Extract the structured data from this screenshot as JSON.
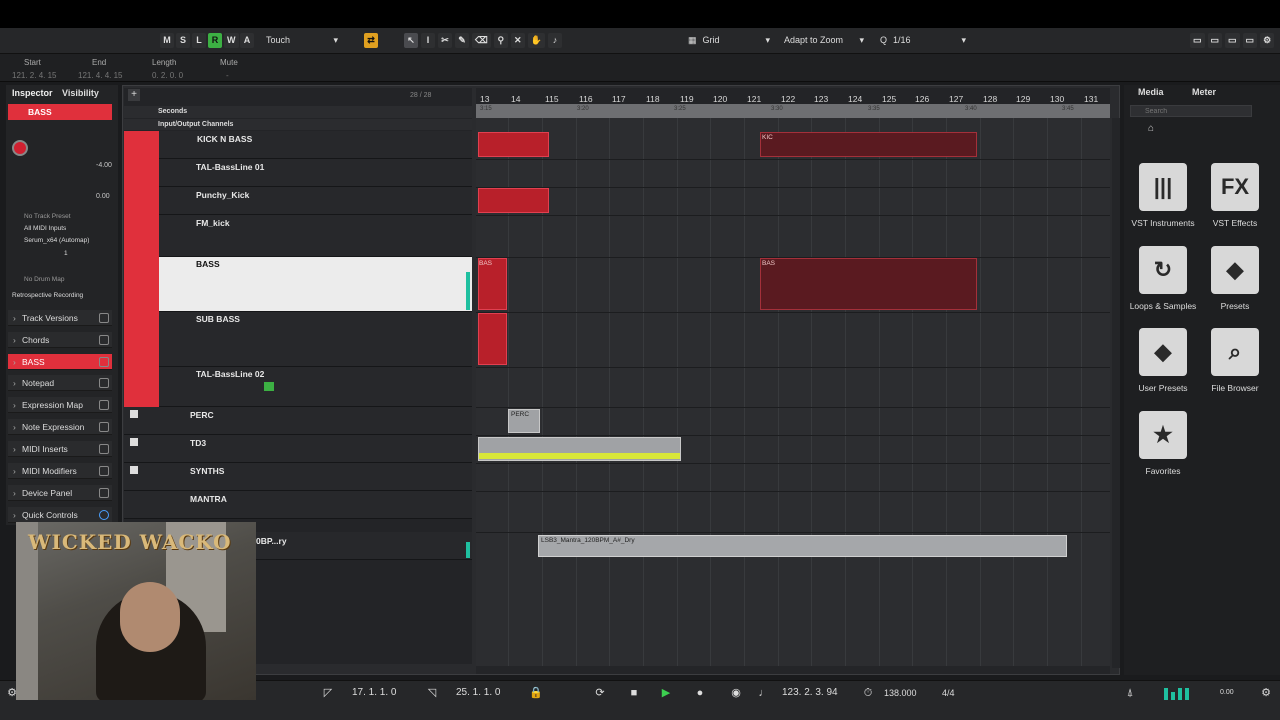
{
  "toolbar": {
    "buttons": [
      "M",
      "S",
      "L",
      "R",
      "W",
      "A"
    ],
    "automation_mode": "Touch",
    "snap_type": "Grid",
    "zoom_mode": "Adapt to Zoom",
    "quantize": "1/16"
  },
  "infoline": {
    "labels": [
      "Start",
      "End",
      "Length",
      "Mute"
    ],
    "values": [
      "121. 2. 4. 15",
      "121. 4. 4. 15",
      "0. 2. 0. 0",
      "-"
    ]
  },
  "inspector": {
    "tabs": [
      "Inspector",
      "Visibility"
    ],
    "track_name": "BASS",
    "volume": "-4.00",
    "pan": "0.00",
    "preset": "No Track Preset",
    "input": "All MIDI Inputs",
    "output": "Serum_x64 (Automap)",
    "channel": "1",
    "drum_map": "No Drum Map",
    "retro": "Retrospective Recording",
    "sections": [
      "Track Versions",
      "Chords",
      "BASS",
      "Notepad",
      "Expression Map",
      "Note Expression",
      "MIDI Inserts",
      "MIDI Modifiers",
      "Device Panel",
      "Quick Controls"
    ]
  },
  "tracklist": {
    "counter": "28 / 28",
    "header_time": "Seconds",
    "io_channels": "Input/Output Channels",
    "tracks": [
      "KICK N BASS",
      "TAL-BassLine 01",
      "Punchy_Kick",
      "FM_kick",
      "BASS",
      "SUB BASS",
      "TAL-BassLine 02",
      "PERC",
      "TD3",
      "SYNTHS",
      "MANTRA"
    ],
    "audio_track_fragment": "0BP...ry"
  },
  "ruler": {
    "bars": [
      "13",
      "14",
      "115",
      "116",
      "117",
      "118",
      "119",
      "120",
      "121",
      "122",
      "123",
      "124",
      "125",
      "126",
      "127",
      "128",
      "129",
      "130",
      "131"
    ],
    "seconds": [
      "3:15",
      "3:20",
      "3:25",
      "3:30",
      "3:35",
      "3:40",
      "3:45"
    ]
  },
  "events": {
    "kick_label": "KIC",
    "bass_label": "BAS",
    "perc_label": "PERC",
    "audio_label": "LSB3_Mantra_120BPM_A#_Dry"
  },
  "media": {
    "tabs": [
      "Media",
      "Meter"
    ],
    "search_placeholder": "Search",
    "tiles": [
      {
        "label": "VST Instruments",
        "glyph": "|||"
      },
      {
        "label": "VST Effects",
        "glyph": "FX"
      },
      {
        "label": "Loops & Samples",
        "glyph": "↻"
      },
      {
        "label": "Presets",
        "glyph": "◆"
      },
      {
        "label": "User Presets",
        "glyph": "◆"
      },
      {
        "label": "File Browser",
        "glyph": "⌕"
      },
      {
        "label": "Favorites",
        "glyph": "★"
      }
    ]
  },
  "transport": {
    "left_locator": "17. 1. 1.    0",
    "right_locator": "25. 1. 1.    0",
    "position": "123. 2. 3. 94",
    "tempo": "138.000",
    "signature": "4/4",
    "level": "0.00"
  },
  "overlay": {
    "logo": "WICKED WACKO"
  }
}
